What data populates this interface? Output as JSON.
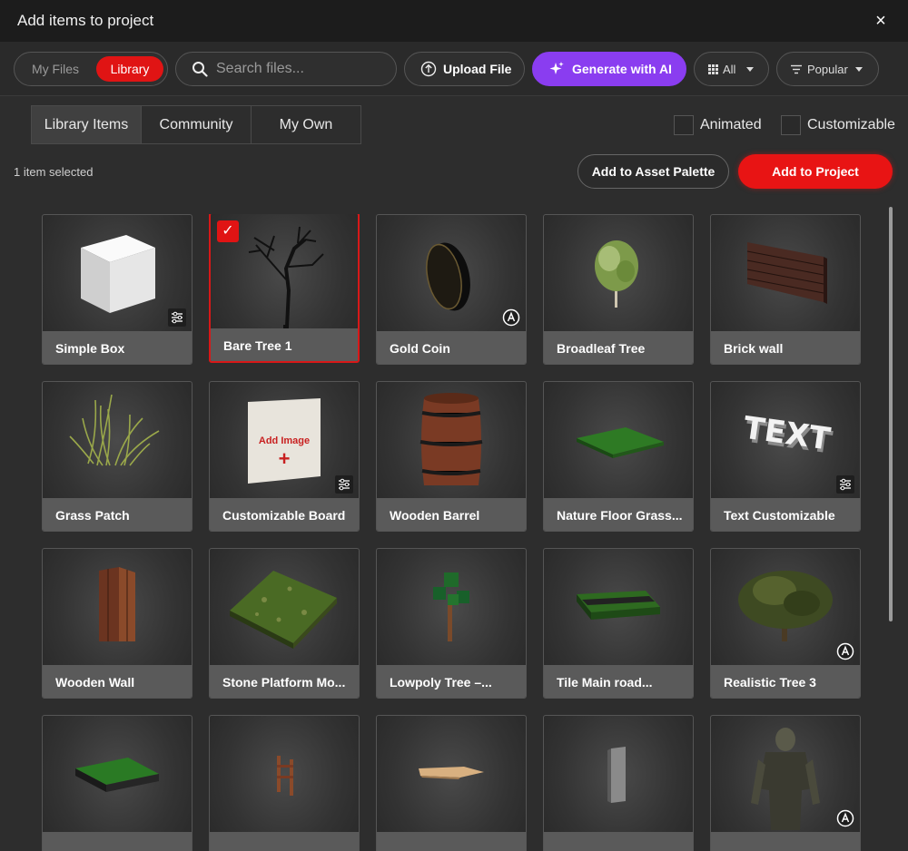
{
  "window": {
    "title": "Add items to project",
    "close_label": "×"
  },
  "toolbar": {
    "source_tabs": [
      "My Files",
      "Library"
    ],
    "active_source": "Library",
    "search_placeholder": "Search files...",
    "upload_label": "Upload File",
    "generate_label": "Generate with AI",
    "filter_label": "All",
    "sort_label": "Popular"
  },
  "tabs": [
    "Library Items",
    "Community",
    "My Own"
  ],
  "active_tab": "Library Items",
  "filters": {
    "animated_label": "Animated",
    "customizable_label": "Customizable"
  },
  "selection": {
    "count_text": "1 item selected"
  },
  "actions": {
    "palette_label": "Add to Asset Palette",
    "add_label": "Add to Project"
  },
  "colors": {
    "accent_red": "#e01414",
    "accent_purple": "#8a3df0",
    "background": "#2d2d2d"
  },
  "items": [
    {
      "name": "Simple Box",
      "thumb": "cube",
      "badge": "customizable",
      "selected": false
    },
    {
      "name": "Bare Tree 1",
      "thumb": "bare-tree",
      "badge": "",
      "selected": true
    },
    {
      "name": "Gold Coin",
      "thumb": "coin",
      "badge": "animated",
      "selected": false
    },
    {
      "name": "Broadleaf Tree",
      "thumb": "broadleaf",
      "badge": "",
      "selected": false
    },
    {
      "name": "Brick wall",
      "thumb": "brick",
      "badge": "",
      "selected": false
    },
    {
      "name": "Grass Patch",
      "thumb": "grass",
      "badge": "",
      "selected": false
    },
    {
      "name": "Customizable Board",
      "thumb": "board",
      "badge": "customizable",
      "selected": false
    },
    {
      "name": "Wooden Barrel",
      "thumb": "barrel",
      "badge": "",
      "selected": false
    },
    {
      "name": "Nature Floor Grass...",
      "thumb": "floor-grass",
      "badge": "",
      "selected": false
    },
    {
      "name": "Text Customizable",
      "thumb": "text3d",
      "badge": "customizable",
      "selected": false
    },
    {
      "name": "Wooden Wall",
      "thumb": "wood-wall",
      "badge": "",
      "selected": false
    },
    {
      "name": "Stone Platform Mo...",
      "thumb": "stone-platform",
      "badge": "",
      "selected": false
    },
    {
      "name": "Lowpoly Tree –...",
      "thumb": "lowpoly-tree",
      "badge": "",
      "selected": false
    },
    {
      "name": "Tile Main road...",
      "thumb": "road-tile",
      "badge": "",
      "selected": false
    },
    {
      "name": "Realistic Tree 3",
      "thumb": "realistic-tree",
      "badge": "animated",
      "selected": false
    },
    {
      "name": "",
      "thumb": "grass-tile",
      "badge": "",
      "selected": false
    },
    {
      "name": "",
      "thumb": "fence",
      "badge": "",
      "selected": false
    },
    {
      "name": "",
      "thumb": "plank",
      "badge": "",
      "selected": false
    },
    {
      "name": "",
      "thumb": "door",
      "badge": "",
      "selected": false
    },
    {
      "name": "",
      "thumb": "zombie",
      "badge": "animated",
      "selected": false
    }
  ],
  "board_text": {
    "line1": "Add Image",
    "line2": "+"
  },
  "text3d_text": "TEXT"
}
